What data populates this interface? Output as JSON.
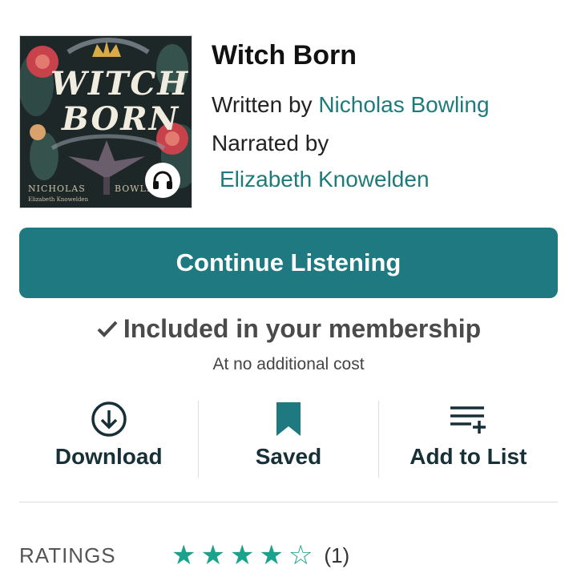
{
  "book": {
    "title": "Witch Born",
    "written_by_label": "Written by",
    "author": "Nicholas Bowling",
    "narrated_by_label": "Narrated by",
    "narrator": "Elizabeth Knowelden",
    "cover": {
      "title_line_1": "WITCH",
      "title_line_2": "BORN",
      "author_left": "NICHOLAS",
      "author_right": "BOWLI",
      "narrator_small": "Elizabeth Knowelden",
      "badge_icon": "headphones-icon"
    }
  },
  "cta": {
    "label": "Continue Listening"
  },
  "membership": {
    "check_icon": "check-icon",
    "label": "Included in your membership",
    "sub": "At no additional cost"
  },
  "actions": [
    {
      "label": "Download",
      "icon": "download-icon"
    },
    {
      "label": "Saved",
      "icon": "bookmark-icon"
    },
    {
      "label": "Add to List",
      "icon": "add-to-list-icon"
    }
  ],
  "ratings": {
    "label": "RATINGS",
    "stars_filled": 4,
    "stars_total": 5,
    "count": "(1)"
  },
  "colors": {
    "accent": "#1e7a80",
    "link": "#1e7b7b",
    "star": "#1aa38c"
  }
}
